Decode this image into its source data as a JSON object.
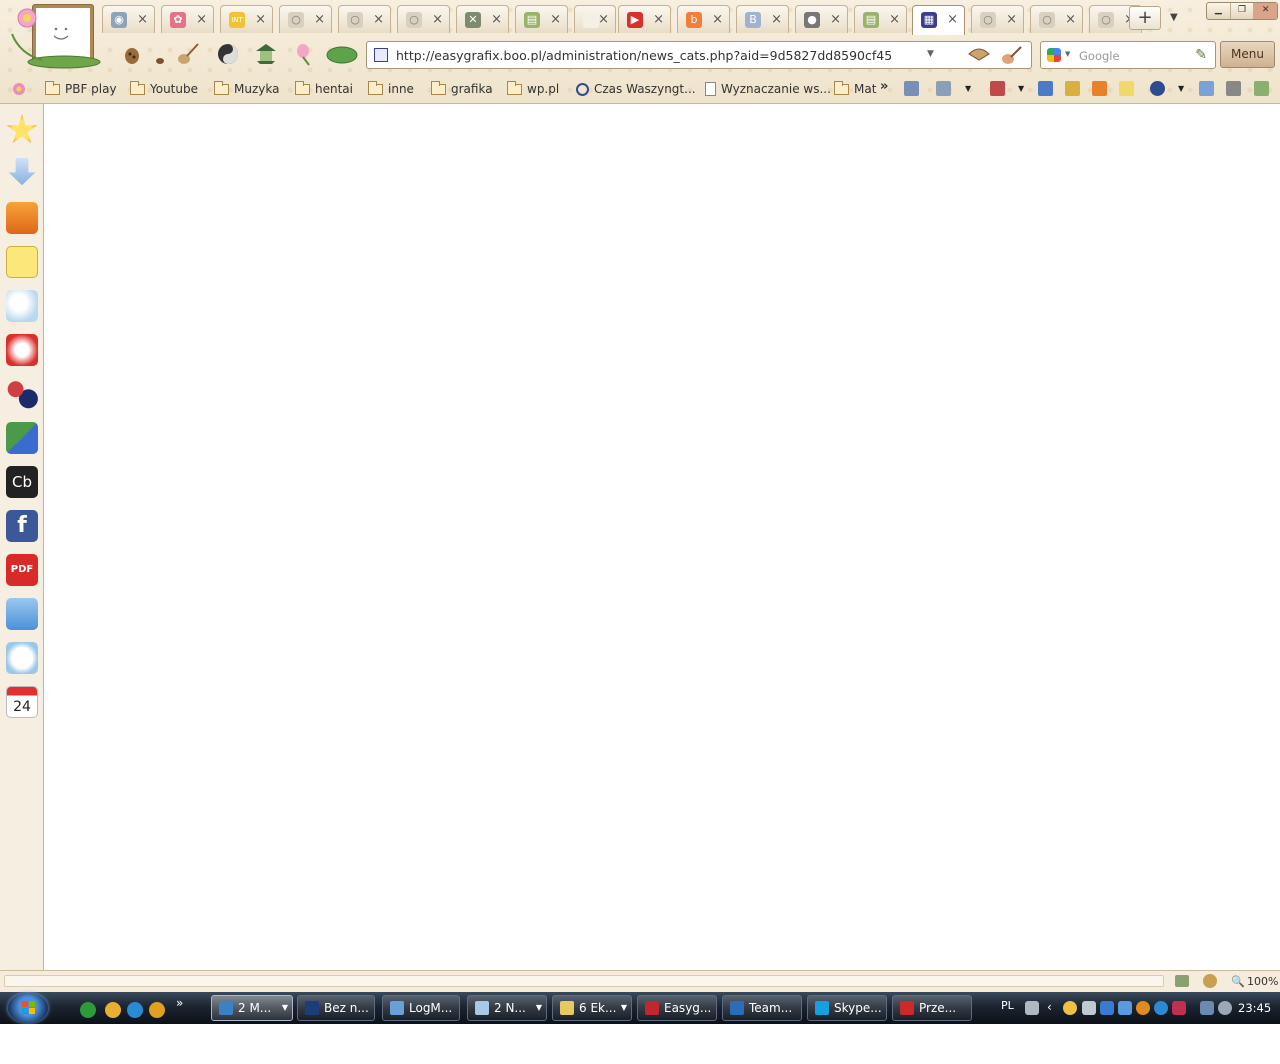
{
  "colors": {
    "theme_bg": "#f5ecdb",
    "taskbar": "#1c2430",
    "accent_url_icon": "#3b3e8c",
    "menu_button": "#cfb191"
  },
  "window": {
    "controls": [
      "minimize-icon",
      "restore-icon",
      "close-icon"
    ]
  },
  "tabs": [
    {
      "icon": "speed-dial-icon",
      "color": "#8fa3b8",
      "glyph": "◉"
    },
    {
      "icon": "flower-icon",
      "color": "#e6728a",
      "glyph": "✿"
    },
    {
      "icon": "int-site-icon",
      "color": "#f2c232",
      "glyph": "INT"
    },
    {
      "icon": "opera-blank-icon",
      "color": "#d8d0c0",
      "glyph": "○"
    },
    {
      "icon": "opera-blank-icon",
      "color": "#d8d0c0",
      "glyph": "○"
    },
    {
      "icon": "opera-blank-icon",
      "color": "#d8d0c0",
      "glyph": "○"
    },
    {
      "icon": "crossed-image-icon",
      "color": "#7c8c6c",
      "glyph": "✕"
    },
    {
      "icon": "page-green-icon",
      "color": "#9ab36a",
      "glyph": "▤"
    },
    {
      "icon": "blank-page-icon",
      "color": "#f5f0e5",
      "glyph": ""
    },
    {
      "icon": "youtube-icon",
      "color": "#d9302b",
      "glyph": "▶"
    },
    {
      "icon": "blogger-icon",
      "color": "#f57d3a",
      "glyph": "b"
    },
    {
      "icon": "b-letter-icon",
      "color": "#9fb3cf",
      "glyph": "B"
    },
    {
      "icon": "user-icon",
      "color": "#777777",
      "glyph": "●"
    },
    {
      "icon": "page-green-icon",
      "color": "#9ab36a",
      "glyph": "▤"
    },
    {
      "icon": "admin-grid-icon",
      "color": "#3b3e8c",
      "glyph": "▦"
    },
    {
      "icon": "opera-blank-icon",
      "color": "#d8d0c0",
      "glyph": "○"
    },
    {
      "icon": "opera-blank-icon",
      "color": "#d8d0c0",
      "glyph": "○"
    },
    {
      "icon": "opera-blank-icon",
      "color": "#d8d0c0",
      "glyph": "○"
    }
  ],
  "tab_close_glyph": "×",
  "new_tab_glyph": "+",
  "tablist_glyph": "▼",
  "address": {
    "url": "http://easygrafix.boo.pl/administration/news_cats.php?aid=9d5827dd8590cf45",
    "dropdown_glyph": "▼"
  },
  "search": {
    "engine": "google-icon",
    "placeholder": "Google"
  },
  "menu_label": "Menu",
  "toolbar_icons": [
    "pinecone-icon",
    "lute-icon",
    "yin-yang-icon",
    "pagoda-icon",
    "lotus-icon",
    "lily-pad-icon",
    "fan-icon",
    "brush-icon"
  ],
  "bookmarks": [
    {
      "label": "PBF play",
      "type": "folder"
    },
    {
      "label": "Youtube",
      "type": "folder"
    },
    {
      "label": "Muzyka",
      "type": "folder"
    },
    {
      "label": "hentai",
      "type": "folder"
    },
    {
      "label": "inne",
      "type": "folder"
    },
    {
      "label": "grafika",
      "type": "folder"
    },
    {
      "label": "wp.pl",
      "type": "folder"
    },
    {
      "label": "Czas Waszyngt...",
      "type": "clock"
    },
    {
      "label": "Wyznaczanie ws...",
      "type": "doc"
    },
    {
      "label": "Mat",
      "type": "folder"
    }
  ],
  "bookmarks_overflow": "»",
  "sidebar": [
    {
      "name": "bookmarks-star-icon"
    },
    {
      "name": "downloads-icon"
    },
    {
      "name": "rss-feeds-icon"
    },
    {
      "name": "notes-icon"
    },
    {
      "name": "weather-icon"
    },
    {
      "name": "youtube-panel-icon"
    },
    {
      "name": "balls-game-icon"
    },
    {
      "name": "translate-icon"
    },
    {
      "name": "cb-icon",
      "text": "Cb"
    },
    {
      "name": "facebook-icon",
      "text": "f"
    },
    {
      "name": "pdf-icon",
      "text": "PDF"
    },
    {
      "name": "dropbox-icon"
    },
    {
      "name": "alarm-clock-icon"
    },
    {
      "name": "calendar-icon",
      "text": "24"
    }
  ],
  "status": {
    "zoom": "100%"
  },
  "taskbar": {
    "quick_launch_overflow": "»",
    "tasks": [
      {
        "label": "2 M...",
        "icon": "opera-task-icon",
        "color": "#3b82c4",
        "grouped": true,
        "active": true
      },
      {
        "label": "Bez n...",
        "icon": "photoshop-icon",
        "color": "#1b3d7a"
      },
      {
        "label": "LogM...",
        "icon": "logmein-icon",
        "color": "#6aa0d8"
      },
      {
        "label": "2 N...",
        "icon": "notepad-icon",
        "color": "#a8c8e8",
        "grouped": true
      },
      {
        "label": "6 Ek...",
        "icon": "explorer-folder-icon",
        "color": "#e8c860",
        "grouped": true
      },
      {
        "label": "Easyg...",
        "icon": "filezilla-icon",
        "color": "#c0282d"
      },
      {
        "label": "Team...",
        "icon": "teamviewer-icon",
        "color": "#2d6cb8"
      },
      {
        "label": "Skype...",
        "icon": "skype-icon",
        "color": "#16a0e0"
      },
      {
        "label": "Prze...",
        "icon": "bug-icon",
        "color": "#cc2a2a"
      }
    ],
    "language": "PL",
    "clock": "23:45"
  }
}
